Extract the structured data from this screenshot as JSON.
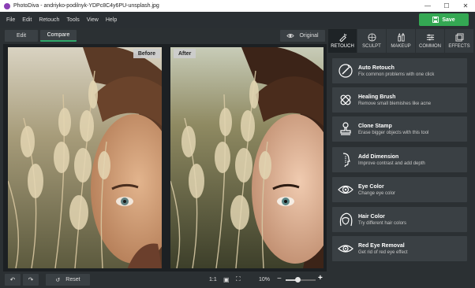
{
  "window": {
    "title": "PhotoDiva - andriyko-podilnyk-YDPc8C4y6PU-unsplash.jpg",
    "controls": [
      "—",
      "☐",
      "✕"
    ]
  },
  "menu": [
    "File",
    "Edit",
    "Retouch",
    "Tools",
    "View",
    "Help"
  ],
  "save_label": "Save",
  "mode": {
    "edit": "Edit",
    "compare": "Compare",
    "active": "compare"
  },
  "original_label": "Original",
  "compare": {
    "before_label": "Before",
    "after_label": "After"
  },
  "bottom": {
    "reset_label": "Reset",
    "ratio_label": "1:1",
    "zoom_value": "10%",
    "zoom_fraction": 0.4
  },
  "tabs": [
    {
      "label": "RETOUCH",
      "icon": "retouch-icon",
      "active": true
    },
    {
      "label": "SCULPT",
      "icon": "sculpt-icon",
      "active": false
    },
    {
      "label": "MAKEUP",
      "icon": "makeup-icon",
      "active": false
    },
    {
      "label": "COMMON",
      "icon": "sliders-icon",
      "active": false
    },
    {
      "label": "EFFECTS",
      "icon": "effects-icon",
      "active": false
    }
  ],
  "tools": [
    {
      "title": "Auto Retouch",
      "desc": "Fix common problems with one click",
      "icon": "auto-retouch-icon"
    },
    {
      "title": "Healing Brush",
      "desc": "Remove small blemishes like acne",
      "icon": "healing-brush-icon"
    },
    {
      "title": "Clone Stamp",
      "desc": "Erase bigger objects with this tool",
      "icon": "clone-stamp-icon"
    },
    {
      "title": "Add Dimension",
      "desc": "Improve contrast and add depth",
      "icon": "add-dimension-icon"
    },
    {
      "title": "Eye Color",
      "desc": "Change eye color",
      "icon": "eye-color-icon"
    },
    {
      "title": "Hair Color",
      "desc": "Try different hair colors",
      "icon": "hair-color-icon"
    },
    {
      "title": "Red Eye Removal",
      "desc": "Get rid of red eye effect",
      "icon": "red-eye-icon"
    }
  ],
  "colors": {
    "accent": "#2fa86b",
    "save": "#34a853"
  }
}
